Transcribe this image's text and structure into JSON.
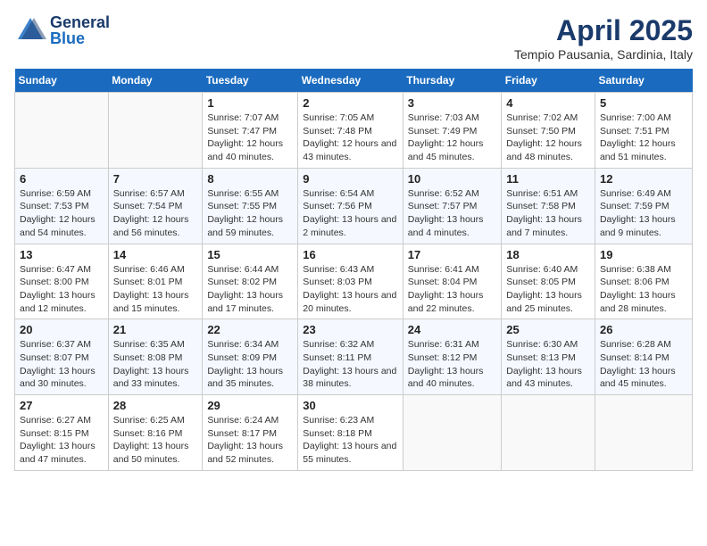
{
  "header": {
    "logo_line1": "General",
    "logo_line2": "Blue",
    "title": "April 2025",
    "subtitle": "Tempio Pausania, Sardinia, Italy"
  },
  "days_of_week": [
    "Sunday",
    "Monday",
    "Tuesday",
    "Wednesday",
    "Thursday",
    "Friday",
    "Saturday"
  ],
  "weeks": [
    [
      {
        "day": "",
        "info": ""
      },
      {
        "day": "",
        "info": ""
      },
      {
        "day": "1",
        "sunrise": "7:07 AM",
        "sunset": "7:47 PM",
        "daylight": "12 hours and 40 minutes."
      },
      {
        "day": "2",
        "sunrise": "7:05 AM",
        "sunset": "7:48 PM",
        "daylight": "12 hours and 43 minutes."
      },
      {
        "day": "3",
        "sunrise": "7:03 AM",
        "sunset": "7:49 PM",
        "daylight": "12 hours and 45 minutes."
      },
      {
        "day": "4",
        "sunrise": "7:02 AM",
        "sunset": "7:50 PM",
        "daylight": "12 hours and 48 minutes."
      },
      {
        "day": "5",
        "sunrise": "7:00 AM",
        "sunset": "7:51 PM",
        "daylight": "12 hours and 51 minutes."
      }
    ],
    [
      {
        "day": "6",
        "sunrise": "6:59 AM",
        "sunset": "7:53 PM",
        "daylight": "12 hours and 54 minutes."
      },
      {
        "day": "7",
        "sunrise": "6:57 AM",
        "sunset": "7:54 PM",
        "daylight": "12 hours and 56 minutes."
      },
      {
        "day": "8",
        "sunrise": "6:55 AM",
        "sunset": "7:55 PM",
        "daylight": "12 hours and 59 minutes."
      },
      {
        "day": "9",
        "sunrise": "6:54 AM",
        "sunset": "7:56 PM",
        "daylight": "13 hours and 2 minutes."
      },
      {
        "day": "10",
        "sunrise": "6:52 AM",
        "sunset": "7:57 PM",
        "daylight": "13 hours and 4 minutes."
      },
      {
        "day": "11",
        "sunrise": "6:51 AM",
        "sunset": "7:58 PM",
        "daylight": "13 hours and 7 minutes."
      },
      {
        "day": "12",
        "sunrise": "6:49 AM",
        "sunset": "7:59 PM",
        "daylight": "13 hours and 9 minutes."
      }
    ],
    [
      {
        "day": "13",
        "sunrise": "6:47 AM",
        "sunset": "8:00 PM",
        "daylight": "13 hours and 12 minutes."
      },
      {
        "day": "14",
        "sunrise": "6:46 AM",
        "sunset": "8:01 PM",
        "daylight": "13 hours and 15 minutes."
      },
      {
        "day": "15",
        "sunrise": "6:44 AM",
        "sunset": "8:02 PM",
        "daylight": "13 hours and 17 minutes."
      },
      {
        "day": "16",
        "sunrise": "6:43 AM",
        "sunset": "8:03 PM",
        "daylight": "13 hours and 20 minutes."
      },
      {
        "day": "17",
        "sunrise": "6:41 AM",
        "sunset": "8:04 PM",
        "daylight": "13 hours and 22 minutes."
      },
      {
        "day": "18",
        "sunrise": "6:40 AM",
        "sunset": "8:05 PM",
        "daylight": "13 hours and 25 minutes."
      },
      {
        "day": "19",
        "sunrise": "6:38 AM",
        "sunset": "8:06 PM",
        "daylight": "13 hours and 28 minutes."
      }
    ],
    [
      {
        "day": "20",
        "sunrise": "6:37 AM",
        "sunset": "8:07 PM",
        "daylight": "13 hours and 30 minutes."
      },
      {
        "day": "21",
        "sunrise": "6:35 AM",
        "sunset": "8:08 PM",
        "daylight": "13 hours and 33 minutes."
      },
      {
        "day": "22",
        "sunrise": "6:34 AM",
        "sunset": "8:09 PM",
        "daylight": "13 hours and 35 minutes."
      },
      {
        "day": "23",
        "sunrise": "6:32 AM",
        "sunset": "8:11 PM",
        "daylight": "13 hours and 38 minutes."
      },
      {
        "day": "24",
        "sunrise": "6:31 AM",
        "sunset": "8:12 PM",
        "daylight": "13 hours and 40 minutes."
      },
      {
        "day": "25",
        "sunrise": "6:30 AM",
        "sunset": "8:13 PM",
        "daylight": "13 hours and 43 minutes."
      },
      {
        "day": "26",
        "sunrise": "6:28 AM",
        "sunset": "8:14 PM",
        "daylight": "13 hours and 45 minutes."
      }
    ],
    [
      {
        "day": "27",
        "sunrise": "6:27 AM",
        "sunset": "8:15 PM",
        "daylight": "13 hours and 47 minutes."
      },
      {
        "day": "28",
        "sunrise": "6:25 AM",
        "sunset": "8:16 PM",
        "daylight": "13 hours and 50 minutes."
      },
      {
        "day": "29",
        "sunrise": "6:24 AM",
        "sunset": "8:17 PM",
        "daylight": "13 hours and 52 minutes."
      },
      {
        "day": "30",
        "sunrise": "6:23 AM",
        "sunset": "8:18 PM",
        "daylight": "13 hours and 55 minutes."
      },
      {
        "day": "",
        "info": ""
      },
      {
        "day": "",
        "info": ""
      },
      {
        "day": "",
        "info": ""
      }
    ]
  ],
  "labels": {
    "sunrise": "Sunrise: ",
    "sunset": "Sunset: ",
    "daylight": "Daylight: "
  },
  "colors": {
    "header_bg": "#1a6bbf",
    "logo_dark": "#1a3a6b",
    "logo_blue": "#1a6bbf"
  }
}
